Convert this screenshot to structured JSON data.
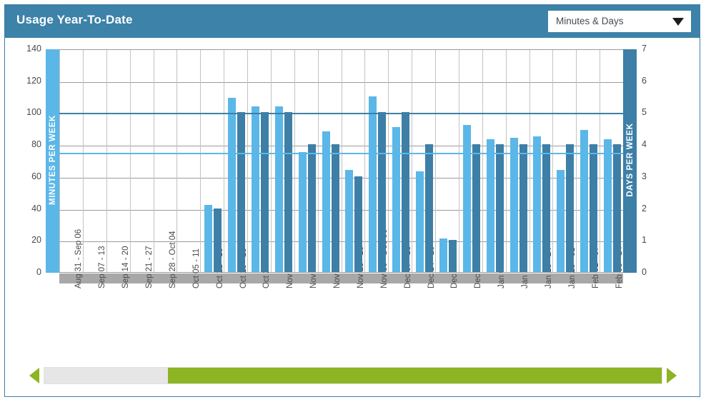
{
  "header": {
    "title": "Usage Year-To-Date",
    "bg_color": "#3d82a8",
    "dropdown": {
      "value": "Minutes & Days",
      "arrow_icon": "chevron-down-icon"
    }
  },
  "scrollbar": {
    "left_arrow_icon": "arrow-left-icon",
    "right_arrow_icon": "arrow-right-icon",
    "thumb_color": "#8cb423",
    "track_color": "#e6e6e6",
    "thumb_start_pct": 20,
    "thumb_width_pct": 80
  },
  "chart_data": {
    "type": "bar",
    "title": "Usage Year-To-Date",
    "xlabel": "",
    "ylabel": "MINUTES PER WEEK",
    "y2label": "DAYS PER WEEK",
    "ylim": [
      0,
      140
    ],
    "y2lim": [
      0,
      7
    ],
    "yticks": [
      0,
      20,
      40,
      60,
      80,
      100,
      120,
      140
    ],
    "y2ticks": [
      0,
      1,
      2,
      3,
      4,
      5,
      6,
      7
    ],
    "grid": true,
    "legend": "none",
    "colors": {
      "minutes": "#5bb7e8",
      "days": "#3d7fa6",
      "target_days_line": "#3d7fa6",
      "target_minutes_line": "#5bb7e8",
      "gridline": "#9b9b9b",
      "baseline_band": "#a8a8a8"
    },
    "annotations": [
      {
        "name": "days-target-line",
        "axis": "y2",
        "value": 5
      },
      {
        "name": "minutes-target-line",
        "axis": "y",
        "value": 75
      }
    ],
    "categories": [
      "Aug 31 - Sep 06",
      "Sep 07 - 13",
      "Sep 14 - 20",
      "Sep 21 - 27",
      "Sep 28 - Oct 04",
      "Oct 05 - 11",
      "Oct 12 - 18",
      "Oct 19 - 25",
      "Oct 26 - Nov 01",
      "Nov 02 - 08",
      "Nov 09 - 15",
      "Nov 16 - 22",
      "Nov 23 - 29",
      "Nov 30 - Dec 06",
      "Dec 07 - 13",
      "Dec 14 - 20",
      "Dec 21 - 27",
      "Dec 28 - Jan 03",
      "Jan 04 - 10",
      "Jan 11 - 17",
      "Jan 18 - 24",
      "Jan 25 - 31",
      "Feb 01 - 07",
      "Feb 08 - 14"
    ],
    "series": [
      {
        "name": "Minutes Per Week",
        "axis": "y",
        "color": "#5bb7e8",
        "values": [
          0,
          0,
          0,
          0,
          0,
          0,
          42,
          109,
          104,
          104,
          75,
          88,
          64,
          110,
          91,
          63,
          21,
          92,
          83,
          84,
          85,
          64,
          89,
          83
        ]
      },
      {
        "name": "Days Per Week",
        "axis": "y2",
        "color": "#3d7fa6",
        "values": [
          0,
          0,
          0,
          0,
          0,
          0,
          2,
          5,
          5,
          5,
          4,
          4,
          3,
          5,
          5,
          4,
          1,
          4,
          4,
          4,
          4,
          4,
          4,
          4
        ]
      }
    ]
  }
}
